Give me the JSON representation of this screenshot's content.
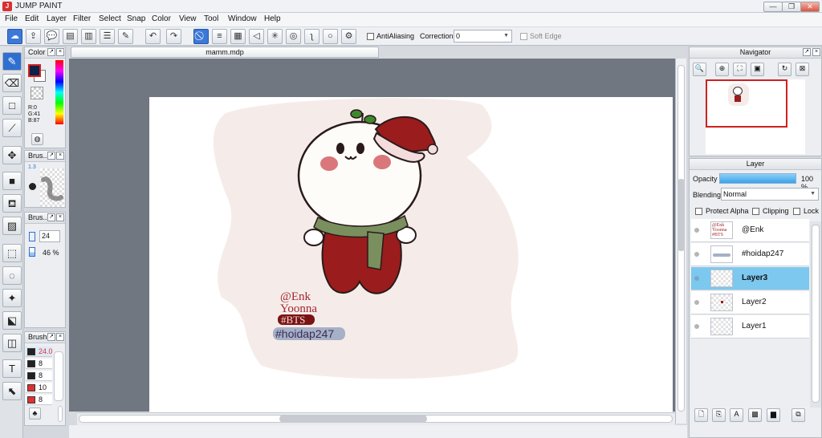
{
  "app": {
    "title": "JUMP PAINT",
    "icon": "app-logo-icon"
  },
  "window_buttons": [
    "—",
    "❐",
    "✕"
  ],
  "menu": [
    "File",
    "Edit",
    "Layer",
    "Filter",
    "Select",
    "Snap",
    "Color",
    "View",
    "Tool",
    "Window",
    "Help"
  ],
  "toolbar": {
    "antialiasing_label": "AntiAliasing",
    "correction_label": "Correction",
    "correction_value": "0",
    "soft_edge_label": "Soft Edge"
  },
  "document": {
    "tab_title": "mamm.mdp"
  },
  "color_panel": {
    "title": "Color",
    "r": "R:0",
    "g": "G:41",
    "b": "B:87",
    "fg_color": "#0c2246"
  },
  "brush_size_panel": {
    "title": "Brus...",
    "size_label": "1.3"
  },
  "brush_panel2": {
    "title": "Brus...",
    "size": "24",
    "opacity": "46 %"
  },
  "brush_list": {
    "title": "Brush",
    "items": [
      {
        "value": "24.0",
        "color": "#222222"
      },
      {
        "value": "8",
        "color": "#222222"
      },
      {
        "value": "8",
        "color": "#222222"
      },
      {
        "value": "10",
        "color": "#e03030"
      },
      {
        "value": "8",
        "color": "#e03030"
      }
    ]
  },
  "navigator": {
    "title": "Navigator"
  },
  "layer_panel": {
    "title": "Layer",
    "opacity_label": "Opacity",
    "opacity_value": "100 %",
    "opacity_fraction": 1.0,
    "blending_label": "Blending",
    "blending_value": "Normal",
    "protect_alpha_label": "Protect Alpha",
    "clipping_label": "Clipping",
    "lock_label": "Lock",
    "layers": [
      {
        "name": "@Enk",
        "selected": false
      },
      {
        "name": "#hoidap247",
        "selected": false
      },
      {
        "name": "Layer3",
        "selected": true
      },
      {
        "name": "Layer2",
        "selected": false
      },
      {
        "name": "Layer1",
        "selected": false
      }
    ]
  },
  "artwork": {
    "line1": "@Enk",
    "line2": "Yoonna",
    "line3": "#BTS",
    "line4": "#hoidap247"
  },
  "colors": {
    "accent": "#2f6fd0",
    "selection": "#7cc8ef",
    "red": "#9b1c1c",
    "scarf": "#7a8f5e"
  }
}
